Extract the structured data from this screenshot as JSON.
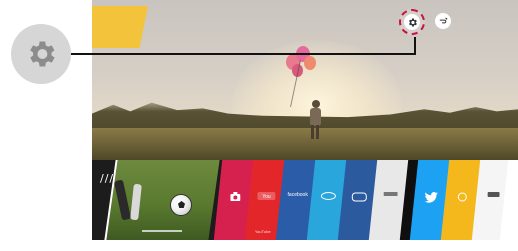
{
  "screen": {
    "launcher_handle": "///"
  },
  "callout": {
    "icon": "gear-icon"
  },
  "top_icons": {
    "settings_icon": "gear-icon",
    "input_icon": "input-icon",
    "highlight_color": "#c8123f"
  },
  "launcher": {
    "apps": [
      {
        "name": "photo-video",
        "label": "",
        "color": "#d6204e"
      },
      {
        "name": "youtube",
        "label": "YouTube",
        "color": "#e3262a"
      },
      {
        "name": "facebook",
        "label": "facebook",
        "color": "#2a5ca8"
      },
      {
        "name": "web-browser",
        "label": "",
        "color": "#29a6db"
      },
      {
        "name": "live-tv",
        "label": "",
        "color": "#2b5b9e"
      },
      {
        "name": "channel",
        "label": "",
        "color": "#e8e8e8"
      },
      {
        "name": "dark",
        "label": "",
        "color": "#0f0f0f"
      },
      {
        "name": "twitter",
        "label": "",
        "color": "#1da1f2"
      },
      {
        "name": "tv-guide",
        "label": "",
        "color": "#f4b81c"
      },
      {
        "name": "hdmi",
        "label": "",
        "color": "#f5f5f5"
      }
    ]
  },
  "colors": {
    "yellow_tile": "#f2c33b",
    "gear_bg": "#d6d6d6",
    "gear_fg": "#8c8c8c"
  }
}
